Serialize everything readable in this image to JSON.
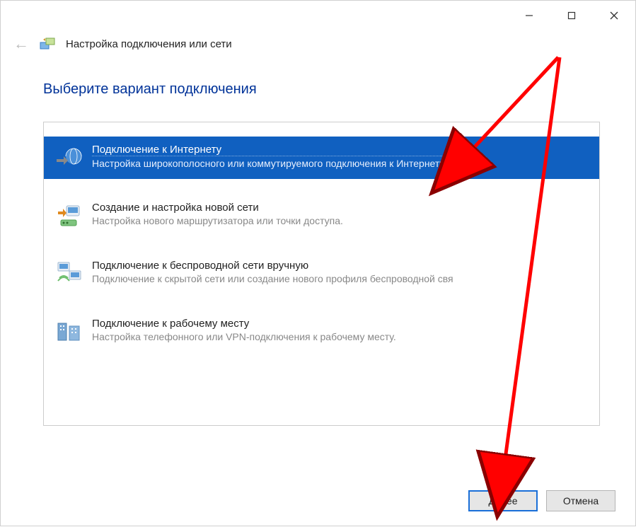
{
  "window": {
    "title": "Настройка подключения или сети"
  },
  "page": {
    "heading": "Выберите вариант подключения"
  },
  "options": [
    {
      "title": "Подключение к Интернету",
      "desc": "Настройка широкополосного или коммутируемого подключения к Интернету.",
      "selected": true
    },
    {
      "title": "Создание и настройка новой сети",
      "desc": "Настройка нового маршрутизатора или точки доступа."
    },
    {
      "title": "Подключение к беспроводной сети вручную",
      "desc": "Подключение к скрытой сети или создание нового профиля беспроводной свя"
    },
    {
      "title": "Подключение к рабочему месту",
      "desc": "Настройка телефонного или VPN-подключения к рабочему месту."
    }
  ],
  "buttons": {
    "next": "Далее",
    "cancel": "Отмена"
  }
}
